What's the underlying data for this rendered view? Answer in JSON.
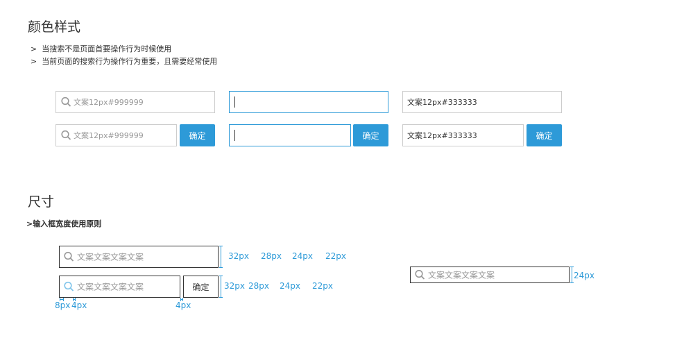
{
  "colors": {
    "accent": "#2d9ad8",
    "border": "#cccccc",
    "placeholder": "#999999",
    "text": "#333333"
  },
  "section_color": {
    "title": "颜色样式",
    "bullets": [
      "当搜索不是页面首要操作行为时候使用",
      "当前页面的搜索行为操作行为重要，且需要经常使用"
    ],
    "placeholder_text": "文案12px#999999",
    "value_text": "文案12px#333333",
    "confirm_label": "确定"
  },
  "section_size": {
    "title": "尺寸",
    "subtitle": ">输入框宽度使用原则",
    "placeholder_text": "文案文案文案文案",
    "confirm_label": "确定",
    "row1_dims": [
      "32px",
      "28px",
      "24px",
      "22px"
    ],
    "row2_dims": [
      "32px",
      "28px",
      "24px",
      "22px"
    ],
    "spacing": {
      "left_pad": "8px",
      "icon_gap": "4px",
      "button_gap": "4px"
    },
    "small_box_dim": "24px"
  },
  "icons": {
    "search": "search-icon",
    "caret": "text-caret"
  }
}
